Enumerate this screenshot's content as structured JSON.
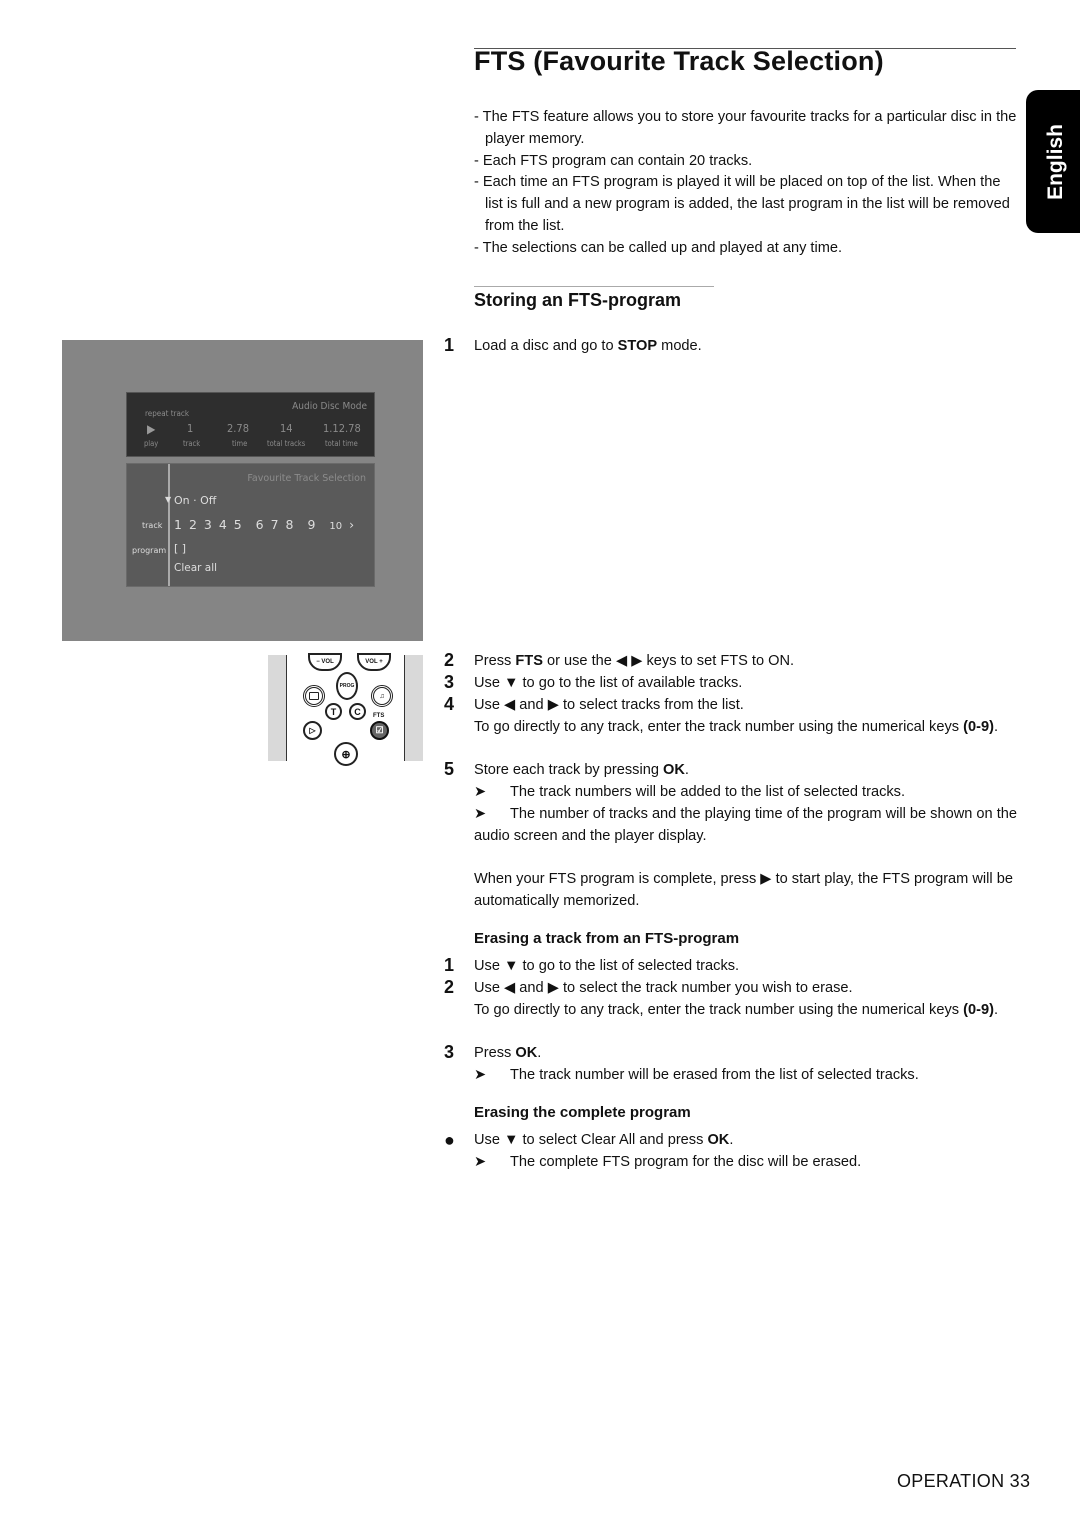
{
  "title": "FTS (Favourite Track Selection)",
  "language_tab": "English",
  "intro": [
    "- The FTS feature allows you to store your favourite tracks for a particular disc in the player memory.",
    "- Each FTS program can contain 20 tracks.",
    "- Each time an FTS program is played it will be placed on top of the list. When the list is full and a new program is added, the last program in the list will be removed from the list.",
    "- The selections can be called up and played at any time."
  ],
  "storing": {
    "heading": "Storing an FTS-program",
    "step1": {
      "num": "1",
      "pre": "Load a disc and go to ",
      "bold": "STOP",
      "post": " mode."
    },
    "step2": {
      "num": "2",
      "pre": "Press ",
      "bold": "FTS",
      "post": " or use the ◀ ▶ keys to set FTS to ON."
    },
    "step3": {
      "num": "3",
      "text": "Use ▼ to go to the list of available tracks."
    },
    "step4": {
      "num": "4",
      "text": "Use ◀ and ▶ to select tracks from the list.",
      "note_pre": "To go directly to any track, enter the track number using the numerical keys ",
      "note_bold": "(0-9)",
      "note_post": "."
    },
    "step5": {
      "num": "5",
      "pre": "Store each track by pressing ",
      "bold": "OK",
      "post": "."
    },
    "arrow1": "The track numbers will be added to the list of selected tracks.",
    "arrow2": "The number of tracks and the playing time of the program will be shown on the audio screen and the player display.",
    "closing": "When your FTS program is complete, press ▶ to start play, the FTS program will be automatically memorized."
  },
  "erase_track": {
    "heading": "Erasing a track from an FTS-program",
    "step1": {
      "num": "1",
      "text": "Use ▼ to go to the list of selected tracks."
    },
    "step2": {
      "num": "2",
      "text": "Use ◀ and ▶ to select the track number you wish to erase.",
      "note_pre": "To go directly to any track, enter the track number using the numerical keys ",
      "note_bold": "(0-9)",
      "note_post": "."
    },
    "step3": {
      "num": "3",
      "pre": "Press ",
      "bold": "OK",
      "post": "."
    },
    "arrow": "The track number will be erased from the list of selected tracks."
  },
  "erase_all": {
    "heading": "Erasing the complete program",
    "bullet_pre": "Use ▼ to select Clear All and press ",
    "bullet_bold": "OK",
    "bullet_post": ".",
    "arrow": "The complete FTS program for the disc will be erased."
  },
  "osd": {
    "repeat": "repeat track",
    "mode": "Audio Disc Mode",
    "values": [
      "1",
      "2.78",
      "14",
      "1.12.78"
    ],
    "labels": [
      "play",
      "track",
      "time",
      "total tracks",
      "total time"
    ],
    "fts_title": "Favourite Track Selection",
    "on": "On",
    "off": "Off",
    "track_label": "track",
    "program_label": "program",
    "tracks": [
      "1",
      "2",
      "3",
      "4",
      "5",
      "6",
      "7",
      "8",
      "9",
      "10"
    ],
    "program_value": "[ ]",
    "clear_all": "Clear all"
  },
  "remote": {
    "vol_minus": "− VOL",
    "vol_plus": "VOL +",
    "prog": "PROG",
    "t": "T",
    "c": "C",
    "fts": "FTS"
  },
  "footer": "OPERATION 33"
}
